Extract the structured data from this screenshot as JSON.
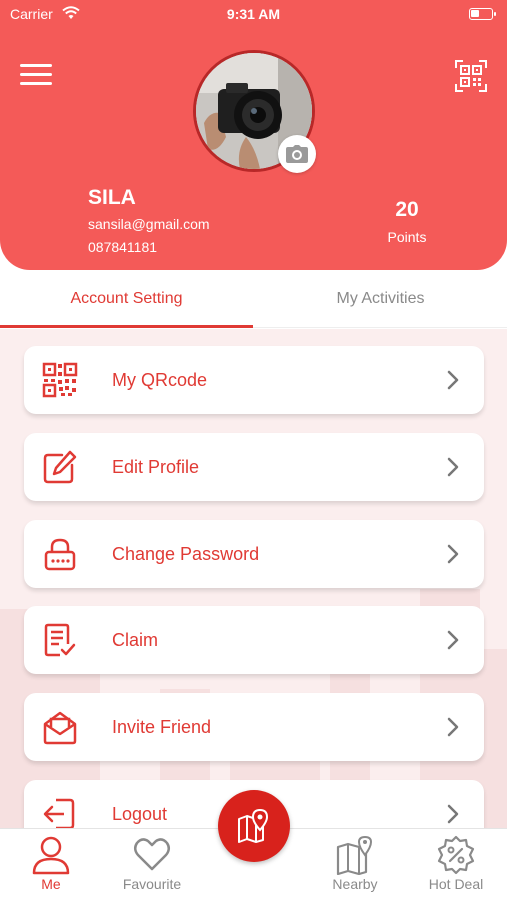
{
  "status_bar": {
    "carrier": "Carrier",
    "time": "9:31 AM"
  },
  "profile": {
    "name": "SILA",
    "email": "sansila@gmail.com",
    "phone": "087841181",
    "points_value": "20",
    "points_label": "Points"
  },
  "tabs": [
    {
      "label": "Account Setting",
      "active": true
    },
    {
      "label": "My Activities",
      "active": false
    }
  ],
  "menu": [
    {
      "label": "My QRcode",
      "icon": "qrcode-icon"
    },
    {
      "label": "Edit Profile",
      "icon": "edit-icon"
    },
    {
      "label": "Change Password",
      "icon": "lock-icon"
    },
    {
      "label": "Claim",
      "icon": "claim-document-icon"
    },
    {
      "label": "Invite Friend",
      "icon": "envelope-icon"
    },
    {
      "label": "Logout",
      "icon": "logout-icon"
    }
  ],
  "bottom_nav": [
    {
      "label": "Me",
      "icon": "user-icon",
      "active": true
    },
    {
      "label": "Favourite",
      "icon": "heart-icon",
      "active": false
    },
    {
      "label": "Nearby",
      "icon": "map-icon",
      "active": false
    },
    {
      "label": "Hot Deal",
      "icon": "discount-badge-icon",
      "active": false
    }
  ],
  "colors": {
    "primary": "#f45a58",
    "accent": "#e03a34",
    "center_button": "#d8221c",
    "inactive": "#8a8a8a"
  }
}
